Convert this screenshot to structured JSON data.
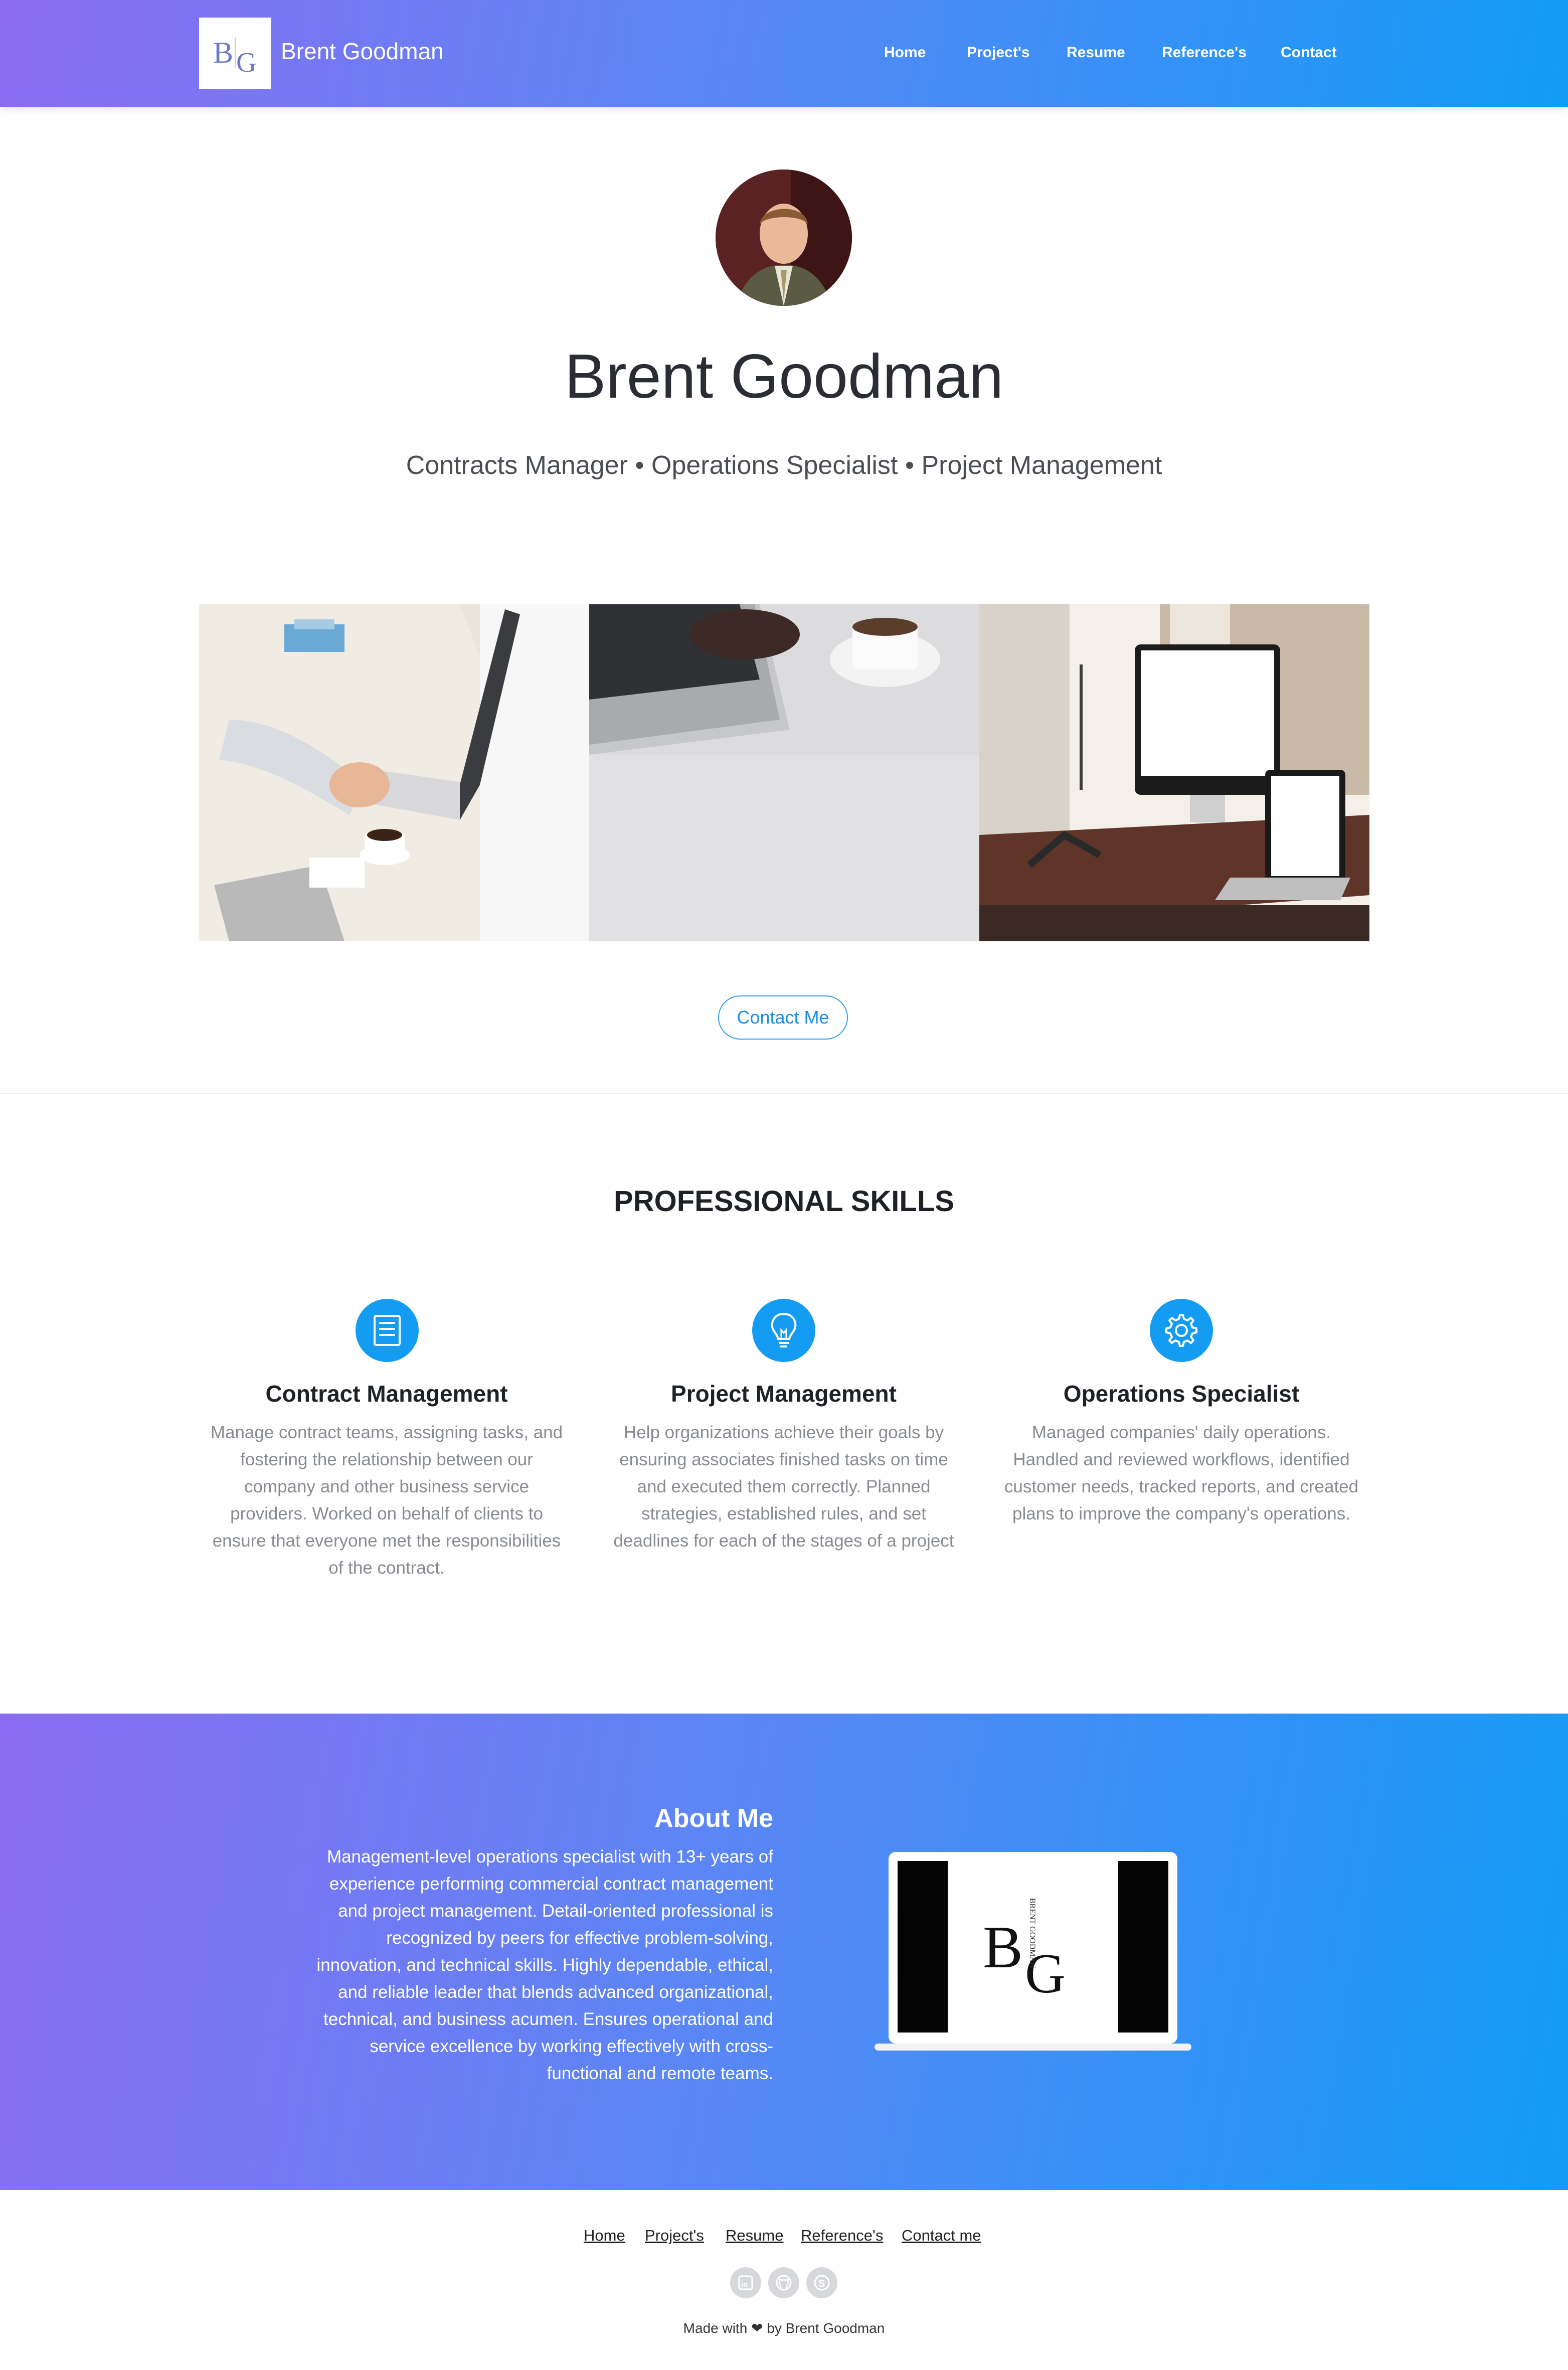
{
  "header": {
    "brand_name": "Brent Goodman",
    "logo_text": "BG",
    "nav": [
      "Home",
      "Project's",
      "Resume",
      "Reference's",
      "Contact"
    ]
  },
  "hero": {
    "name": "Brent Goodman",
    "subtitle": "Contracts Manager • Operations Specialist • Project Management",
    "contact_button": "Contact Me"
  },
  "gallery": [
    "laptop-typing-photo",
    "laptop-coffee-photo",
    "desk-computers-photo"
  ],
  "skills": {
    "title": "PROFESSIONAL SKILLS",
    "items": [
      {
        "icon": "document-icon",
        "title": "Contract Management",
        "description": "Manage contract teams, assigning tasks, and fostering the relationship between our company and other business service providers. Worked on behalf of clients to ensure that everyone met the responsibilities of the contract."
      },
      {
        "icon": "lightbulb-icon",
        "title": "Project Management",
        "description": "Help organizations achieve their goals by ensuring associates finished tasks on time and executed them correctly. Planned strategies, established rules, and set deadlines for each of the stages of a project"
      },
      {
        "icon": "gear-icon",
        "title": "Operations Specialist",
        "description": "Managed companies' daily operations. Handled and reviewed workflows, identified customer needs, tracked reports, and created plans to improve the company's operations."
      }
    ]
  },
  "about": {
    "title": "About Me",
    "text": "Management-level operations specialist with 13+ years of experience performing commercial contract management and project management. Detail-oriented professional is recognized by peers for effective problem-solving, innovation, and technical skills. Highly dependable, ethical, and reliable leader that blends advanced organizational, technical, and business acumen. Ensures operational and service excellence by working effectively with cross-functional and remote teams.",
    "laptop_logo_text": "BG",
    "laptop_logo_caption": "BRENT GOODMAN"
  },
  "footer": {
    "links": [
      "Home",
      "Project's",
      "Resume",
      "Reference's",
      "Contact me"
    ],
    "social": [
      "linkedin-icon",
      "github-icon",
      "skype-icon"
    ],
    "made_with": "Made with ❤ by Brent Goodman"
  },
  "colors": {
    "gradient_start": "#8b6cf2",
    "gradient_end": "#129cf7",
    "accent": "#149cf3"
  }
}
